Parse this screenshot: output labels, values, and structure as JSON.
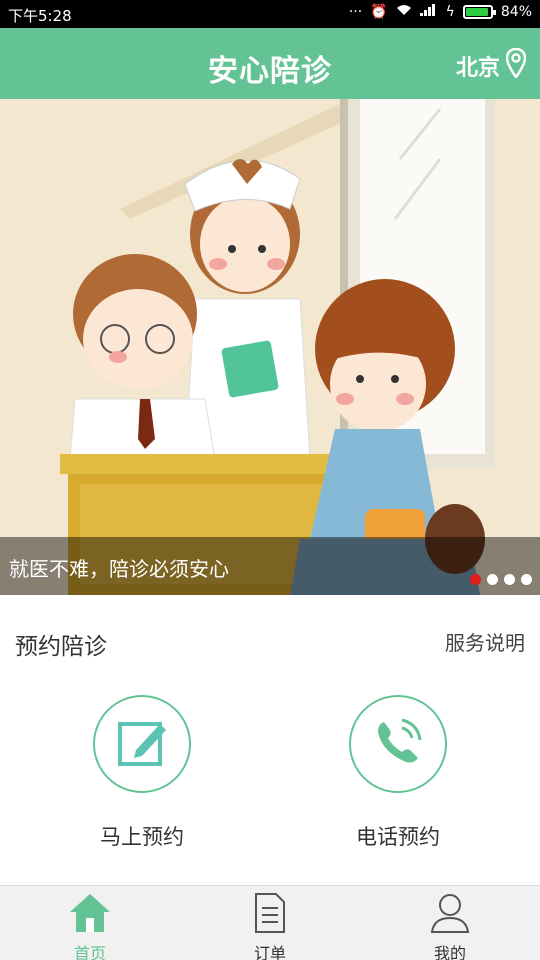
{
  "status_bar": {
    "time": "下午5:28",
    "battery_text": "84%",
    "battery_level": 0.84
  },
  "header": {
    "title": "安心陪诊",
    "city": "北京",
    "icons": [
      "location-pin-icon"
    ]
  },
  "banner": {
    "caption": "就医不难，陪诊必须安心",
    "slide_count": 4,
    "active_slide": 1
  },
  "section": {
    "title": "预约陪诊",
    "link": "服务说明"
  },
  "actions": [
    {
      "label": "马上预约",
      "icon": "edit-pen-icon"
    },
    {
      "label": "电话预约",
      "icon": "phone-call-icon"
    }
  ],
  "bottom_nav": [
    {
      "label": "首页",
      "icon": "home-icon",
      "active": true
    },
    {
      "label": "订单",
      "icon": "document-icon",
      "active": false
    },
    {
      "label": "我的",
      "icon": "user-icon",
      "active": false
    }
  ],
  "colors": {
    "primary": "#64c394",
    "dot_active": "#e01b1b"
  }
}
